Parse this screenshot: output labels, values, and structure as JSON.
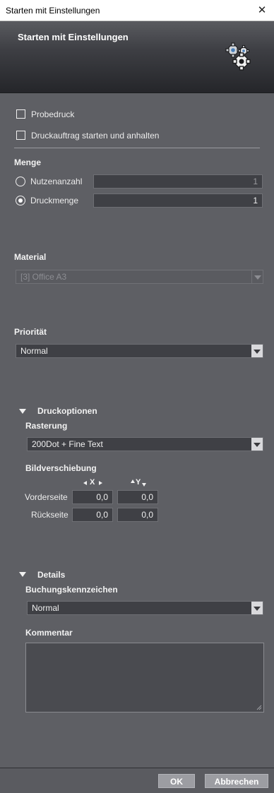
{
  "window": {
    "title": "Starten mit Einstellungen",
    "close_glyph": "✕"
  },
  "header": {
    "title": "Starten mit Einstellungen",
    "icon": "gears-icon"
  },
  "options": {
    "probedruck": {
      "label": "Probedruck",
      "checked": false
    },
    "start_pause": {
      "label": "Druckauftrag starten und anhalten",
      "checked": false
    }
  },
  "menge": {
    "heading": "Menge",
    "nutzenanzahl": {
      "label": "Nutzenanzahl",
      "value": "1",
      "selected": false
    },
    "druckmenge": {
      "label": "Druckmenge",
      "value": "1",
      "selected": true
    }
  },
  "material": {
    "heading": "Material",
    "value": "[3] Office A3",
    "enabled": false
  },
  "prioritaet": {
    "heading": "Priorität",
    "value": "Normal"
  },
  "druckoptionen": {
    "heading": "Druckoptionen",
    "expanded": true,
    "rasterung": {
      "label": "Rasterung",
      "value": "200Dot + Fine Text"
    },
    "bildverschiebung": {
      "label": "Bildverschiebung",
      "x_header": "X",
      "y_header": "Y",
      "vorderseite": {
        "label": "Vorderseite",
        "x": "0,0",
        "y": "0,0"
      },
      "rueckseite": {
        "label": "Rückseite",
        "x": "0,0",
        "y": "0,0"
      }
    }
  },
  "details": {
    "heading": "Details",
    "expanded": true,
    "buchungskennzeichen": {
      "label": "Buchungskennzeichen",
      "value": "Normal"
    },
    "kommentar": {
      "label": "Kommentar",
      "value": ""
    }
  },
  "footer": {
    "ok_label": "OK",
    "cancel_label": "Abbrechen"
  },
  "colors": {
    "background": "#5e5f64",
    "field": "#3f4045",
    "header_dark": "#25262a",
    "button": "#9c9da2"
  }
}
